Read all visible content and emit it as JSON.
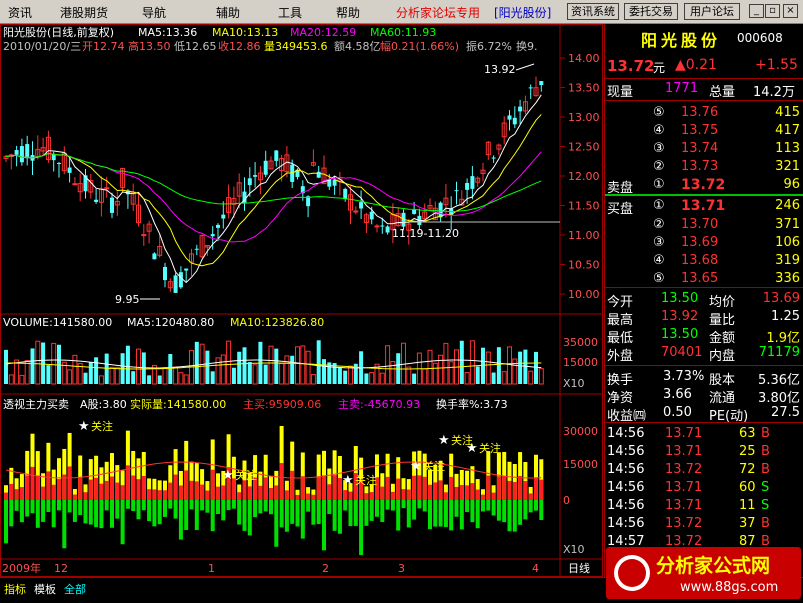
{
  "menubar": {
    "items": [
      "资讯",
      "港股期货",
      "导航",
      "辅助",
      "工具",
      "帮助"
    ],
    "forum_text": "分析家论坛专用",
    "stock_link": "[阳光股份]",
    "buttons": [
      "资讯系统",
      "委托交易",
      "用户论坛"
    ],
    "window_buttons": [
      "_",
      "▫",
      "×"
    ]
  },
  "chart": {
    "header1": "阳光股份(日线,前复权)",
    "ma5": "MA5:13.36",
    "ma10": "MA10:13.13",
    "ma20": "MA20:12.59",
    "ma60": "MA60:11.93",
    "info_date": "2010/01/20/三",
    "info_open": "开12.74",
    "info_high": "高13.50",
    "info_low": "低12.65",
    "info_close": "收12.86",
    "info_vol": "量349453.6",
    "info_amt": "额4.58亿",
    "info_chg": "幅0.21(1.66%)",
    "info_amp": "振6.72%",
    "info_turn": "换9.",
    "price_axis": [
      "14.00",
      "13.50",
      "13.00",
      "12.50",
      "12.00",
      "11.50",
      "11.00",
      "10.50",
      "10.00"
    ],
    "annot_high": "13.92",
    "annot_low": "9.95",
    "annot_range": "11.19-11.20",
    "volume_header": "VOLUME:141580.00",
    "vol_ma5": "MA5:120480.80",
    "vol_ma10": "MA10:123826.80",
    "vol_axis": [
      "35000",
      "15000"
    ],
    "x10": "X10",
    "ind_header": "透视主力买卖",
    "ind_a": "A股:3.80",
    "ind_actual": "实际量:141580.00",
    "ind_buy": "主买:95909.06",
    "ind_sell": "主卖:-45670.93",
    "ind_turn": "换手率%:3.73",
    "ind_axis": [
      "30000",
      "15000",
      "0"
    ],
    "star_label": "关注",
    "x_axis": [
      "2009年",
      "12",
      "1",
      "2",
      "3",
      "4"
    ],
    "period": "日线"
  },
  "quote": {
    "name": "阳光股份",
    "code": "000608",
    "price": "13.72",
    "unit": "元",
    "change": "▲0.21",
    "change_pct": "+1.55",
    "now_label": "现量",
    "now_val": "1771",
    "total_label": "总量",
    "total_val": "14.2万",
    "sells": [
      {
        "n": "⑤",
        "p": "13.76",
        "v": "415"
      },
      {
        "n": "④",
        "p": "13.75",
        "v": "417"
      },
      {
        "n": "③",
        "p": "13.74",
        "v": "113"
      },
      {
        "n": "②",
        "p": "13.73",
        "v": "321"
      }
    ],
    "sell1": {
      "label": "卖盘",
      "n": "①",
      "p": "13.72",
      "v": "96"
    },
    "buy1": {
      "label": "买盘",
      "n": "①",
      "p": "13.71",
      "v": "246"
    },
    "buys": [
      {
        "n": "②",
        "p": "13.70",
        "v": "371"
      },
      {
        "n": "③",
        "p": "13.69",
        "v": "106"
      },
      {
        "n": "④",
        "p": "13.68",
        "v": "319"
      },
      {
        "n": "⑤",
        "p": "13.65",
        "v": "336"
      }
    ],
    "stats": [
      {
        "l1": "今开",
        "v1": "13.50",
        "l2": "均价",
        "v2": "13.69"
      },
      {
        "l1": "最高",
        "v1": "13.92",
        "l2": "量比",
        "v2": "1.25"
      },
      {
        "l1": "最低",
        "v1": "13.50",
        "l2": "金额",
        "v2": "1.9亿"
      },
      {
        "l1": "外盘",
        "v1": "70401",
        "l2": "内盘",
        "v2": "71179"
      }
    ],
    "stats2": [
      {
        "l1": "换手",
        "v1": "3.73%",
        "l2": "股本",
        "v2": "5.36亿"
      },
      {
        "l1": "净资",
        "v1": "3.66",
        "l2": "流通",
        "v2": "3.80亿"
      },
      {
        "l1": "收益㈣",
        "v1": "0.50",
        "l2": "PE(动)",
        "v2": "27.5"
      }
    ],
    "ticks": [
      {
        "t": "14:56",
        "p": "13.71",
        "v": "63",
        "s": "B"
      },
      {
        "t": "14:56",
        "p": "13.71",
        "v": "25",
        "s": "B"
      },
      {
        "t": "14:56",
        "p": "13.72",
        "v": "72",
        "s": "B"
      },
      {
        "t": "14:56",
        "p": "13.71",
        "v": "60",
        "s": "S"
      },
      {
        "t": "14:56",
        "p": "13.71",
        "v": "11",
        "s": "S"
      },
      {
        "t": "14:56",
        "p": "13.72",
        "v": "37",
        "s": "B"
      },
      {
        "t": "14:57",
        "p": "13.72",
        "v": "87",
        "s": "B"
      }
    ]
  },
  "bottom": {
    "tabs": [
      "指标",
      "模板",
      "全部"
    ]
  },
  "watermark": {
    "title": "分析家公式网",
    "url": "www.88gs.com"
  },
  "colors": {
    "up": "#ff3232",
    "down": "#54ffff",
    "ma5": "#ffffff",
    "ma10": "#ffff00",
    "ma20": "#ff00ff",
    "ma60": "#00ff00"
  }
}
